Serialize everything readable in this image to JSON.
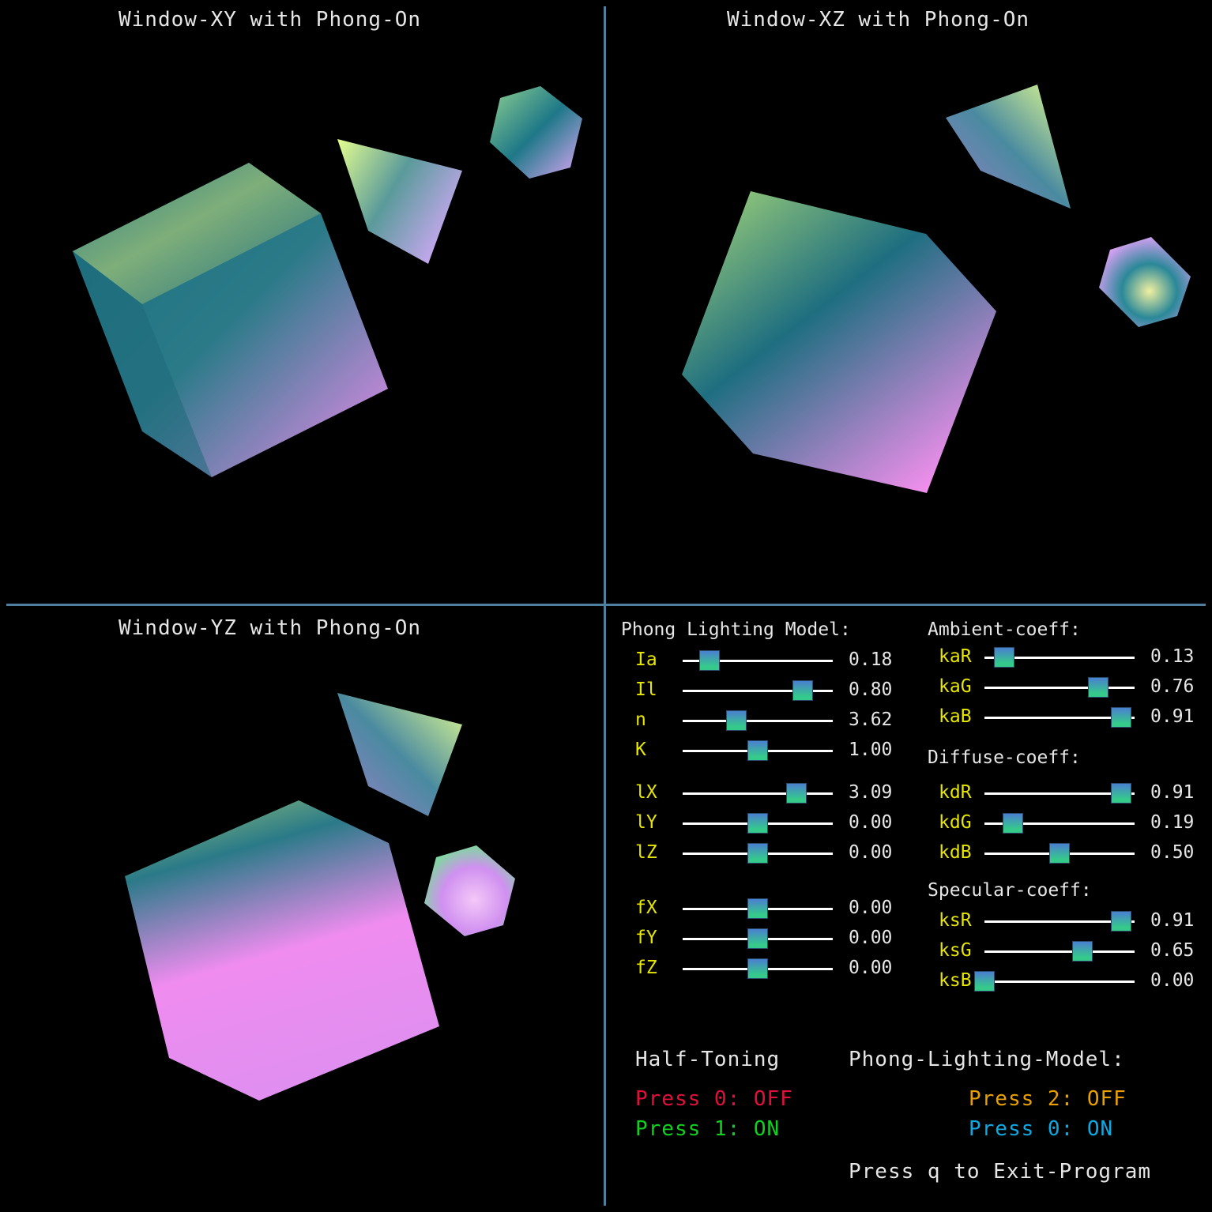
{
  "views": {
    "xy_title": "Window-XY with Phong-On",
    "xz_title": "Window-XZ with Phong-On",
    "yz_title": "Window-YZ with Phong-On"
  },
  "panel": {
    "phong_header": "Phong Lighting Model:",
    "ambient_header": "Ambient-coeff:",
    "diffuse_header": "Diffuse-coeff:",
    "specular_header": "Specular-coeff:",
    "left_sliders": [
      {
        "label": "Ia",
        "value": "0.18",
        "fraction": 0.18
      },
      {
        "label": "Il",
        "value": "0.80",
        "fraction": 0.8
      },
      {
        "label": "n",
        "value": "3.62",
        "fraction": 0.36
      },
      {
        "label": "K",
        "value": "1.00",
        "fraction": 0.5
      },
      {
        "label": "lX",
        "value": "3.09",
        "fraction": 0.76
      },
      {
        "label": "lY",
        "value": "0.00",
        "fraction": 0.5
      },
      {
        "label": "lZ",
        "value": "0.00",
        "fraction": 0.5
      },
      {
        "label": "fX",
        "value": "0.00",
        "fraction": 0.5
      },
      {
        "label": "fY",
        "value": "0.00",
        "fraction": 0.5
      },
      {
        "label": "fZ",
        "value": "0.00",
        "fraction": 0.5
      }
    ],
    "right_sliders": [
      {
        "label": "kaR",
        "value": "0.13",
        "fraction": 0.13
      },
      {
        "label": "kaG",
        "value": "0.76",
        "fraction": 0.76
      },
      {
        "label": "kaB",
        "value": "0.91",
        "fraction": 0.91
      },
      {
        "label": "kdR",
        "value": "0.91",
        "fraction": 0.91
      },
      {
        "label": "kdG",
        "value": "0.19",
        "fraction": 0.19
      },
      {
        "label": "kdB",
        "value": "0.50",
        "fraction": 0.5
      },
      {
        "label": "ksR",
        "value": "0.91",
        "fraction": 0.91
      },
      {
        "label": "ksG",
        "value": "0.65",
        "fraction": 0.65
      },
      {
        "label": "ksB",
        "value": "0.00",
        "fraction": 0.0
      }
    ],
    "half_toning_title": "Half-Toning",
    "half_off": "Press 0: OFF",
    "half_on": "Press 1: ON",
    "phong_model_title": "Phong-Lighting-Model:",
    "phong_off": "Press 2: OFF",
    "phong_on": "Press 0: ON",
    "exit_text": "Press q to Exit-Program"
  },
  "colors": {
    "divider": "#4f7f9f",
    "label": "#e6e600",
    "off_red": "#e0103a",
    "on_green": "#10d020",
    "off_orange": "#e8a000",
    "on_cyan": "#10a8e0"
  }
}
